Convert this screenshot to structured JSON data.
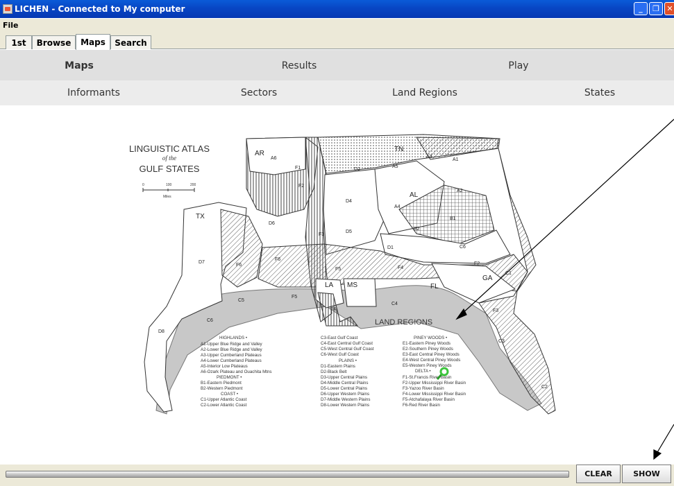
{
  "window": {
    "title": "LICHEN - Connected to My computer"
  },
  "menu": {
    "file": "File"
  },
  "tabs": [
    {
      "label": "1st",
      "active": false
    },
    {
      "label": "Browse",
      "active": false
    },
    {
      "label": "Maps",
      "active": true
    },
    {
      "label": "Search",
      "active": false
    }
  ],
  "nav_primary": [
    "Maps",
    "Results",
    "Play"
  ],
  "nav_secondary": [
    "Informants",
    "Sectors",
    "Land Regions",
    "States"
  ],
  "map": {
    "title_line1": "LINGUISTIC ATLAS",
    "title_line2": "of the",
    "title_line3": "GULF STATES",
    "scale": [
      "0",
      "100",
      "200"
    ],
    "scale_unit": "Miles",
    "heading": "LAND REGIONS",
    "state_labels": [
      "AR",
      "TN",
      "TX",
      "AL",
      "LA",
      "MS",
      "FL",
      "GA"
    ],
    "region_labels": [
      "A1",
      "A2",
      "A3",
      "A4",
      "A5",
      "A6",
      "B1",
      "B2",
      "C1",
      "C2",
      "C3",
      "C4",
      "C5",
      "C6",
      "D1",
      "D2",
      "D3",
      "D4",
      "D5",
      "D6",
      "D7",
      "D8",
      "E1",
      "E2",
      "E3",
      "E4",
      "E5",
      "F1",
      "F2",
      "F3",
      "F4",
      "F5",
      "F6"
    ],
    "legend": {
      "col1": [
        "HIGHLANDS •",
        "A1-Upper Blue Ridge and Valley",
        "A2-Lower Blue Ridge and Valley",
        "A3-Upper Cumberland Plateaus",
        "A4-Lower Cumberland Plateaus",
        "A5-Interior Low Plateaus",
        "A6-Ozark Plateau and Ouachita Mtns",
        "PIEDMONT •",
        "B1-Eastern Piedmont",
        "B2-Western Piedmont",
        "COAST •",
        "C1-Upper Atlantic Coast",
        "C2-Lower Atlantic Coast"
      ],
      "col2": [
        "C3-East Gulf Coast",
        "C4-East Central Gulf Coast",
        "C5-West Central Gulf Coast",
        "C6-West Gulf Coast",
        "PLAINS •",
        "D1-Eastern Plains",
        "D2-Black Belt",
        "D3-Upper Central Plains",
        "D4-Middle Central Plains",
        "D5-Lower Central Plains",
        "D6-Upper Western Plains",
        "D7-Middle Western Plains",
        "D8-Lower Western Plains"
      ],
      "col3": [
        "PINEY WOODS •",
        "E1-Eastern Piney Woods",
        "E2-Southern Piney Woods",
        "E3-East Central Piney Woods",
        "E4-West Central Piney Woods",
        "E5-Western Piney Woods",
        "DELTA •",
        "F1-St.Francis River Basin",
        "F2-Upper Mississippi River Basin",
        "F3-Yazoo River Basin",
        "F4-Lower Mississippi River Basin",
        "F5-Atchafalaya River Basin",
        "F6-Red River Basin"
      ]
    }
  },
  "buttons": {
    "clear": "CLEAR",
    "show": "SHOW"
  },
  "colors": {
    "titlebar": "#0846c4",
    "marker": "#3cc43c",
    "water": "#bdbdbd"
  }
}
